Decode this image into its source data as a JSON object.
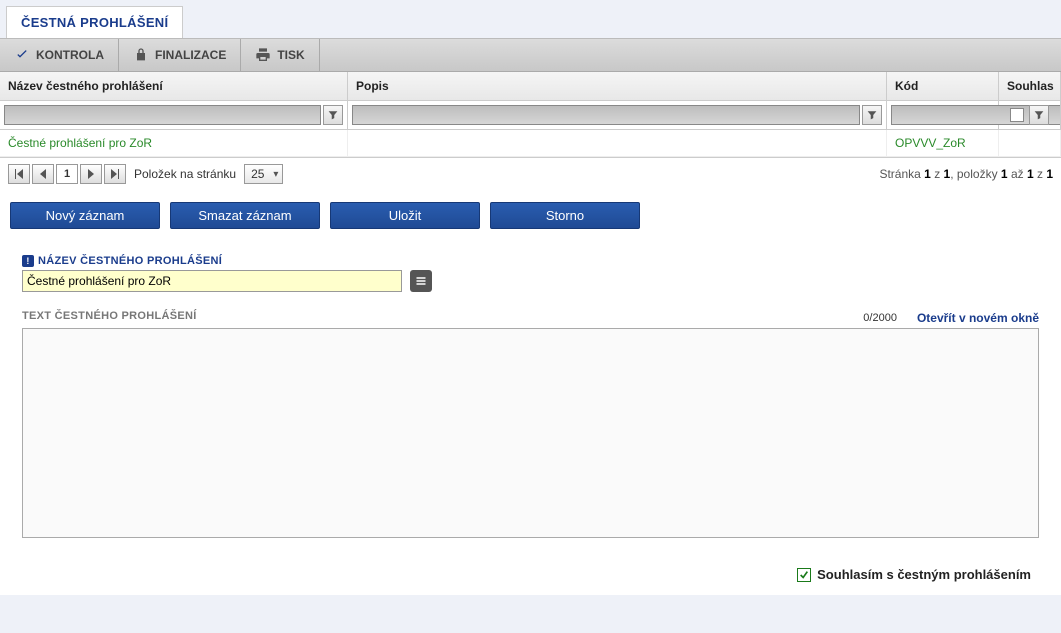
{
  "tab": {
    "title": "ČESTNÁ PROHLÁŠENÍ"
  },
  "toolbar": {
    "kontrola": "KONTROLA",
    "finalizace": "FINALIZACE",
    "tisk": "TISK"
  },
  "grid": {
    "headers": {
      "nazev": "Název čestného prohlášení",
      "popis": "Popis",
      "kod": "Kód",
      "souhlas": "Souhlas"
    },
    "row": {
      "nazev": "Čestné prohlášení pro ZoR",
      "popis": "",
      "kod": "OPVVV_ZoR",
      "souhlas": ""
    }
  },
  "pager": {
    "current_page": "1",
    "items_label": "Položek na stránku",
    "page_size": "25",
    "summary_prefix": "Stránka ",
    "summary_page": "1",
    "summary_of": " z ",
    "summary_total_pages": "1",
    "summary_items_prefix": ", položky ",
    "summary_from": "1",
    "summary_to_word": " až ",
    "summary_to": "1",
    "summary_of2": " z ",
    "summary_total_items": "1"
  },
  "buttons": {
    "novy": "Nový záznam",
    "smazat": "Smazat záznam",
    "ulozit": "Uložit",
    "storno": "Storno"
  },
  "form": {
    "nazev_label": "NÁZEV ČESTNÉHO PROHLÁŠENÍ",
    "nazev_value": "Čestné prohlášení pro ZoR",
    "text_label": "TEXT ČESTNÉHO PROHLÁŠENÍ",
    "char_count": "0/2000",
    "open_new": "Otevřít v novém okně",
    "text_value": ""
  },
  "consent": {
    "label": "Souhlasím s čestným prohlášením"
  }
}
